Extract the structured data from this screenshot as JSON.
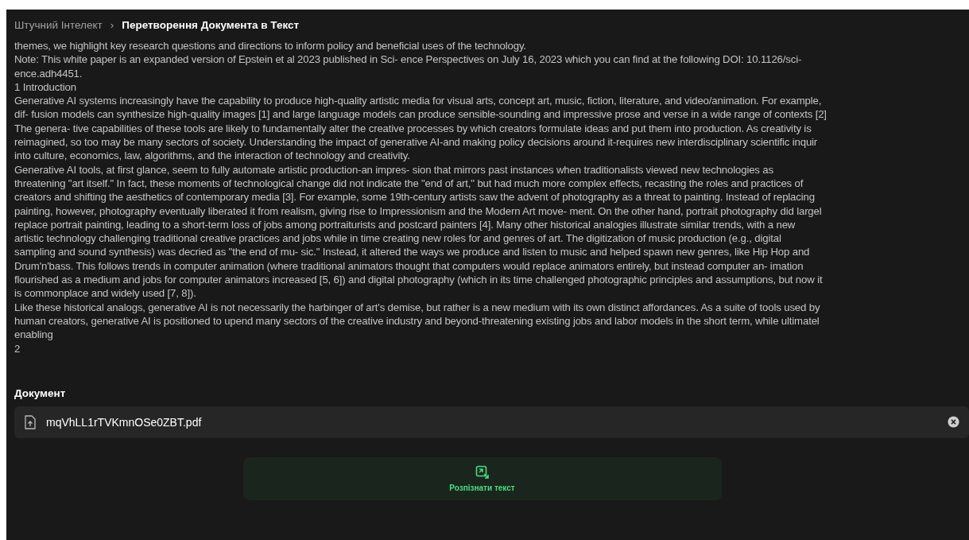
{
  "breadcrumb": [
    {
      "label": "Штучний Інтелект",
      "selected": false
    },
    {
      "label": "Перетворення Документа в Текст",
      "selected": true
    }
  ],
  "separator": "›",
  "text_lines": [
    "themes, we highlight key research questions and directions to inform policy and beneficial uses of the technology.",
    "Note: This white paper is an expanded version of Epstein et al 2023 published in Sci- ence Perspectives on July 16, 2023 which you can find at the following DOI: 10.1126/sci-",
    "ence.adh4451.",
    "1 Introduction",
    "Generative AI systems increasingly have the capability to produce high-quality artistic media for visual arts, concept art, music, fiction, literature, and video/animation. For example,",
    "dif- fusion models can synthesize high-quality images [1] and large language models can produce sensible-sounding and impressive prose and verse in a wide range of contexts [2]",
    "The genera- tive capabilities of these tools are likely to fundamentally alter the creative processes by which creators formulate ideas and put them into production. As creativity is",
    "reimagined, so too may be many sectors of society. Understanding the impact of generative AI-and making policy decisions around it-requires new interdisciplinary scientific inquir",
    "into culture, economics, law, algorithms, and the interaction of technology and creativity.",
    "Generative AI tools, at first glance, seem to fully automate artistic production-an impres- sion that mirrors past instances when traditionalists viewed new technologies as",
    "threatening \"art itself.\" In fact, these moments of technological change did not indicate the \"end of art,\" but had much more complex effects, recasting the roles and practices of",
    "creators and shifting the aesthetics of contemporary media [3]. For example, some 19th-century artists saw the advent of photography as a threat to painting. Instead of replacing",
    "painting, however, photography eventually liberated it from realism, giving rise to Impressionism and the Modern Art move- ment. On the other hand, portrait photography did largel",
    "replace portrait painting, leading to a short-term loss of jobs among portraiturists and postcard painters [4]. Many other historical analogies illustrate similar trends, with a new",
    "artistic technology challenging traditional creative practices and jobs while in time creating new roles for and genres of art. The digitization of music production (e.g., digital",
    "sampling and sound synthesis) was decried as \"the end of mu- sic.\" Instead, it altered the ways we produce and listen to music and helped spawn new genres, like Hip Hop and",
    "Drum'n'bass. This follows trends in computer animation (where traditional animators thought that computers would replace animators entirely, but instead computer an- imation",
    "flourished as a medium and jobs for computer animators increased [5, 6]) and digital photography (which in its time challenged photographic principles and assumptions, but now it",
    "is commonplace and widely used [7, 8]).",
    "Like these historical analogs, generative AI is not necessarily the harbinger of art's demise, but rather is a new medium with its own distinct affordances. As a suite of tools used by",
    "human creators, generative AI is positioned to upend many sectors of the creative industry and beyond-threatening existing jobs and labor models in the short term, while ultimatel",
    "enabling",
    "2"
  ],
  "document": {
    "label": "Документ",
    "file_name": "mqVhLL1rTVKmnOSe0ZBT.pdf"
  },
  "action_button": {
    "label": "Розпізнати текст"
  }
}
